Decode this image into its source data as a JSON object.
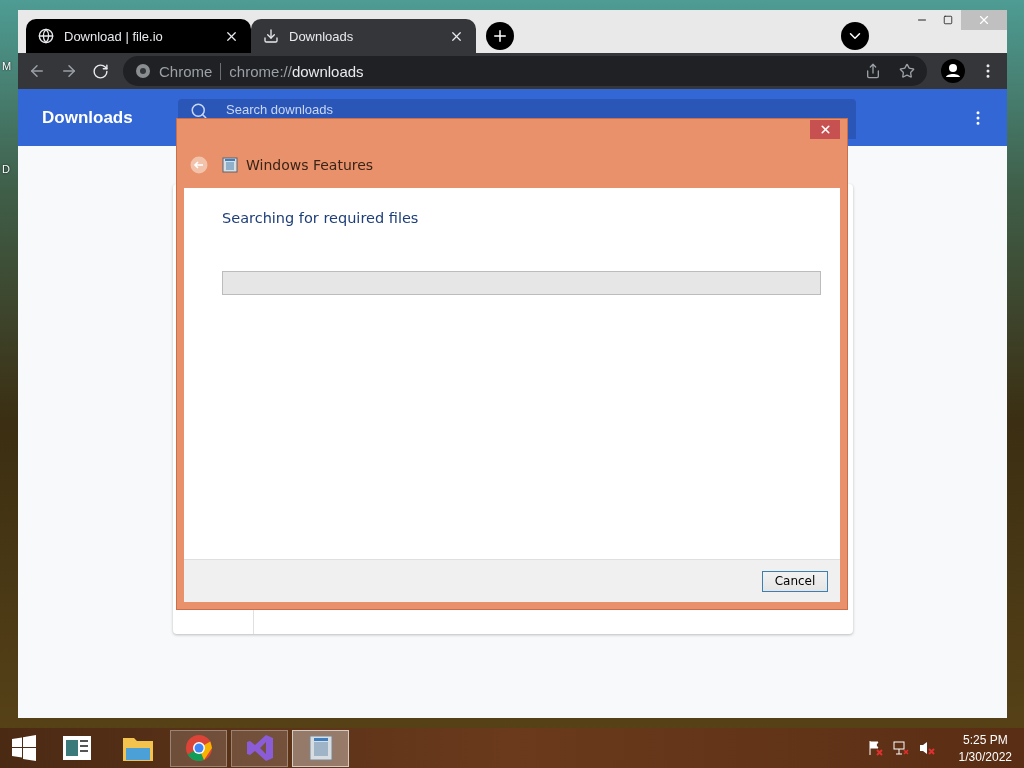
{
  "desktop": {
    "icon_labels": [
      "M",
      "D"
    ]
  },
  "browser": {
    "tabs": [
      {
        "title": "Download | file.io",
        "kind": "web",
        "selected": false
      },
      {
        "title": "Downloads",
        "kind": "download",
        "selected": true
      }
    ],
    "omnibox": {
      "site_chip": "Chrome",
      "url_prefix": "chrome://",
      "url_path": "downloads"
    }
  },
  "page": {
    "title": "Downloads",
    "search": {
      "placeholder": "Search downloads"
    }
  },
  "dialog": {
    "title": "Windows Features",
    "heading": "Searching for required files",
    "progress": {
      "level": 0
    },
    "buttons": [
      "Cancel"
    ]
  },
  "taskbar": {
    "apps": [
      {
        "kind": "notes",
        "running": false,
        "selected": false
      },
      {
        "kind": "folder",
        "running": false,
        "selected": false
      },
      {
        "kind": "chrome",
        "running": true,
        "selected": false
      },
      {
        "kind": "studio",
        "running": true,
        "selected": false
      },
      {
        "kind": "features",
        "running": true,
        "selected": true
      }
    ],
    "clock": {
      "time": "5:25 PM",
      "date": "1/30/2022"
    }
  }
}
